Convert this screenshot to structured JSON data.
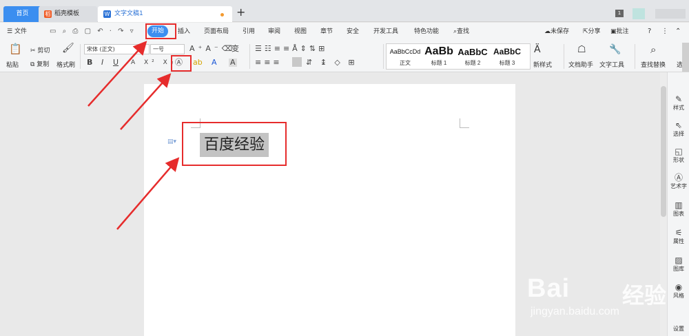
{
  "tabs": {
    "home": "首页",
    "templates": "稻壳模板",
    "document": "文字文稿1"
  },
  "menu": {
    "file": "文件",
    "start": "开始",
    "insert": "插入",
    "layout": "页面布局",
    "references": "引用",
    "review": "审阅",
    "view": "视图",
    "sections": "章节",
    "security": "安全",
    "developer": "开发工具",
    "features": "特色功能",
    "search": "查找",
    "unsaved": "未保存",
    "share": "分享",
    "comment": "批注"
  },
  "ribbon": {
    "paste": "粘贴",
    "cut": "剪切",
    "copy": "复制",
    "format_painter": "格式刷",
    "font_name": "宋体 (正文)",
    "font_size": "一号",
    "bold": "B",
    "italic": "I",
    "underline": "U",
    "new_style": "新样式",
    "doc_helper": "文档助手",
    "text_tools": "文字工具",
    "find_replace": "查找替换",
    "select": "选"
  },
  "styles": [
    {
      "preview": "AaBbCcDd",
      "label": "正文"
    },
    {
      "preview": "AaBb",
      "label": "标题 1"
    },
    {
      "preview": "AaBbC",
      "label": "标题 2"
    },
    {
      "preview": "AaBbC",
      "label": "标题 3"
    }
  ],
  "document": {
    "selected_text": "百度经验"
  },
  "sidebar": [
    "样式",
    "选择",
    "形状",
    "艺术字",
    "图表",
    "属性",
    "图库",
    "风格",
    "设置"
  ],
  "watermark": {
    "brand": "Bai",
    "brand_tail": "经验",
    "url": "jingyan.baidu.com"
  },
  "colors": {
    "accent": "#3b8ef0",
    "annotation": "#e62c2c"
  }
}
